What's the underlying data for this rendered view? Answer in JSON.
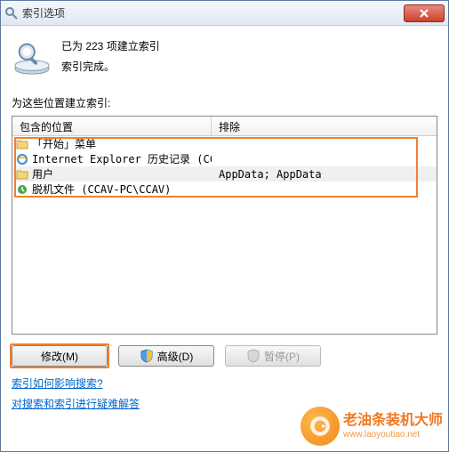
{
  "window": {
    "title": "索引选项"
  },
  "status": {
    "line1": "已为 223 项建立索引",
    "line2": "索引完成。"
  },
  "section_label": "为这些位置建立索引:",
  "columns": {
    "included": "包含的位置",
    "exclude": "排除"
  },
  "rows": [
    {
      "icon": "folder",
      "name": "「开始」菜单",
      "exclude": ""
    },
    {
      "icon": "ie",
      "name": "Internet Explorer 历史记录 (CCA...",
      "exclude": ""
    },
    {
      "icon": "folder",
      "name": "用户",
      "exclude": "AppData; AppData"
    },
    {
      "icon": "offline",
      "name": "脱机文件 (CCAV-PC\\CCAV)",
      "exclude": ""
    }
  ],
  "buttons": {
    "modify": "修改(M)",
    "advanced": "高级(D)",
    "pause": "暂停(P)"
  },
  "links": {
    "affect": "索引如何影响搜索?",
    "troubleshoot": "对搜索和索引进行疑难解答"
  },
  "watermark": {
    "title": "老油条装机大师",
    "url": "www.laoyoutiao.net"
  }
}
